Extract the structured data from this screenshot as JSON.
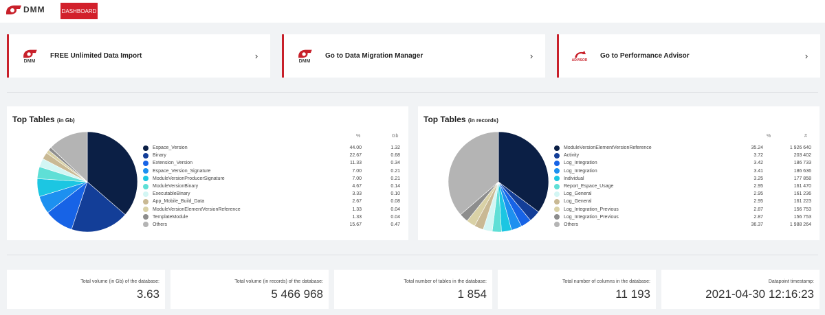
{
  "header": {
    "logo_text": "DMM",
    "dashboard_label": "DASHBOARD"
  },
  "cards": [
    {
      "label": "FREE Unlimited Data Import",
      "logo": "DMM"
    },
    {
      "label": "Go to Data Migration Manager",
      "logo": "DMM"
    },
    {
      "label": "Go to Performance Advisor",
      "logo": "PERFORMANCE ADVISOR"
    }
  ],
  "chart_data": [
    {
      "type": "pie",
      "title": "Top Tables",
      "subtitle": "(in Gb)",
      "col_pct": "%",
      "col_val": "Gb",
      "labels": [
        "Espace_Version",
        "Binary",
        "Extension_Version",
        "Espace_Version_Signature",
        "ModuleVersionProducerSignature",
        "ModuleVersionBinary",
        "ExecutableBinary",
        "App_Mobile_Build_Data",
        "ModuleVersionElementVersionReference",
        "TemplateModule",
        "Others"
      ],
      "percent": [
        "44.00",
        "22.67",
        "11.33",
        "7.00",
        "7.00",
        "4.67",
        "3.33",
        "2.67",
        "1.33",
        "1.33",
        "15.67"
      ],
      "values": [
        "1.32",
        "0.68",
        "0.34",
        "0.21",
        "0.21",
        "0.14",
        "0.10",
        "0.08",
        "0.04",
        "0.04",
        "0.47"
      ]
    },
    {
      "type": "pie",
      "title": "Top Tables",
      "subtitle": "(in records)",
      "col_pct": "%",
      "col_val": "#",
      "labels": [
        "ModuleVersionElementVersionReference",
        "Activity",
        "Log_Integration",
        "Log_Integration",
        "Individual",
        "Report_Espace_Usage",
        "Log_General",
        "Log_General",
        "Log_Integration_Previous",
        "Log_Integration_Previous",
        "Others"
      ],
      "percent": [
        "35.24",
        "3.72",
        "3.42",
        "3.41",
        "3.25",
        "2.95",
        "2.95",
        "2.95",
        "2.87",
        "2.87",
        "36.37"
      ],
      "values": [
        "1 926 640",
        "203 402",
        "186 733",
        "186 636",
        "177 858",
        "161 470",
        "161 236",
        "161 223",
        "156 753",
        "156 753",
        "1 988 264"
      ]
    }
  ],
  "colors": [
    "#0b1f45",
    "#133e98",
    "#1763e6",
    "#1d90f0",
    "#1cc6e2",
    "#5fdfd6",
    "#d3f6f4",
    "#c9b994",
    "#d9d1a6",
    "#8d8d8d",
    "#b4b4b4"
  ],
  "stats": [
    {
      "label": "Total volume (in Gb) of the database:",
      "value": "3.63"
    },
    {
      "label": "Total volume (in records) of the database:",
      "value": "5 466 968"
    },
    {
      "label": "Total number of tables in the database:",
      "value": "1 854"
    },
    {
      "label": "Total number of columns in the database:",
      "value": "11 193"
    },
    {
      "label": "Datapoint timestamp:",
      "value": "2021-04-30 12:16:23"
    }
  ]
}
